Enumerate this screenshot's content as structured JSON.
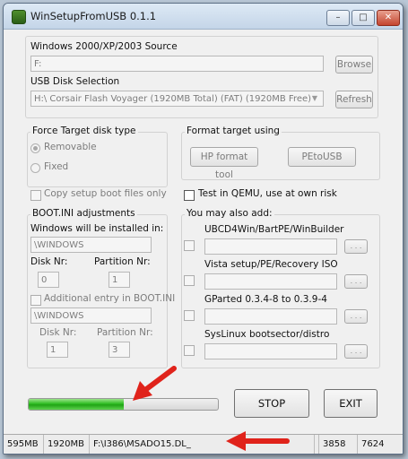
{
  "window": {
    "title": "WinSetupFromUSB 0.1.1",
    "min_glyph": "–",
    "max_glyph": "□",
    "close_glyph": "✕"
  },
  "source": {
    "label": "Windows 2000/XP/2003 Source",
    "value": "F:",
    "browse_label": "Browse"
  },
  "usb": {
    "label": "USB Disk Selection",
    "value": "H:\\ Corsair Flash Voyager (1920MB Total) (FAT) (1920MB Free)",
    "arrow_glyph": "▼",
    "refresh_label": "Refresh"
  },
  "force_target": {
    "title": "Force Target disk type",
    "removable_label": "Removable",
    "fixed_label": "Fixed"
  },
  "format_target": {
    "title": "Format target using",
    "hp_label": "HP format tool",
    "petousb_label": "PEtoUSB"
  },
  "options": {
    "copy_boot_label": "Copy setup boot files only",
    "qemu_label": "Test in QEMU, use at own risk"
  },
  "bootini": {
    "title": "BOOT.INI adjustments",
    "installed_label": "Windows will be installed in:",
    "installed_value": "\\WINDOWS",
    "disk_label": "Disk Nr:",
    "disk_value": "0",
    "partition_label": "Partition Nr:",
    "partition_value": "1",
    "additional_label": "Additional entry in BOOT.INI",
    "additional_value": "\\WINDOWS",
    "disk2_label": "Disk Nr:",
    "disk2_value": "1",
    "partition2_label": "Partition Nr:",
    "partition2_value": "3"
  },
  "also_add": {
    "title": "You may also add:",
    "items": [
      {
        "label": "UBCD4Win/BartPE/WinBuilder",
        "browse": ". . ."
      },
      {
        "label": "Vista setup/PE/Recovery ISO",
        "browse": ". . ."
      },
      {
        "label": "GParted 0.3.4-8 to 0.3.9-4",
        "browse": ". . ."
      },
      {
        "label": "SysLinux bootsector/distro",
        "browse": ". . ."
      }
    ]
  },
  "progress": {
    "fraction": 0.5
  },
  "actions": {
    "stop_label": "STOP",
    "exit_label": "EXIT"
  },
  "status": {
    "cells": [
      "595MB",
      "1920MB",
      "F:\\I386\\MSADO15.DL_",
      "",
      "3858",
      "7624"
    ]
  },
  "colors": {
    "annotation_arrow": "#e0231b",
    "progress": "#2fbd23"
  }
}
